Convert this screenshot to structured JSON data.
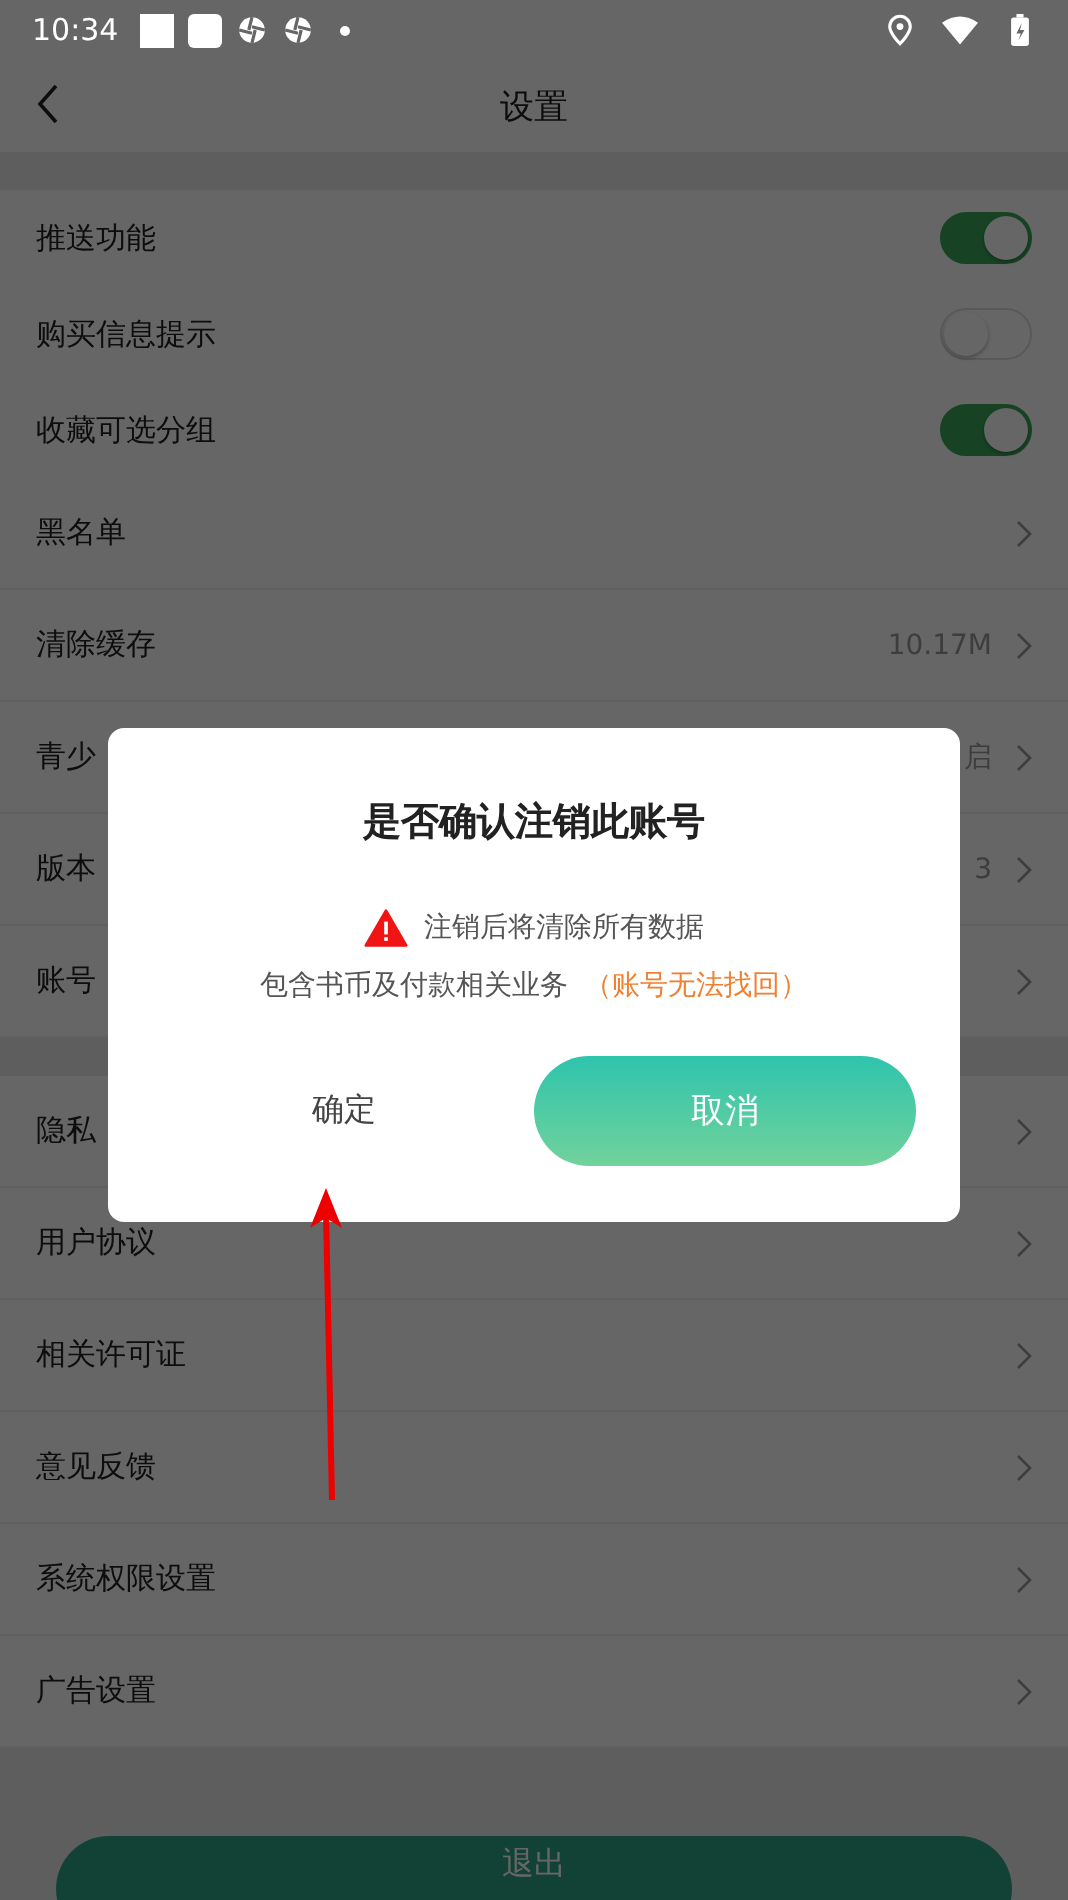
{
  "status_bar": {
    "time": "10:34"
  },
  "header": {
    "title": "设置"
  },
  "groups": [
    {
      "items": [
        {
          "label": "推送功能",
          "kind": "toggle",
          "on": true
        },
        {
          "label": "购买信息提示",
          "kind": "toggle",
          "on": false
        },
        {
          "label": "收藏可选分组",
          "kind": "toggle",
          "on": true
        },
        {
          "label": "黑名单",
          "kind": "link"
        },
        {
          "label": "清除缓存",
          "kind": "link",
          "value": "10.17M"
        },
        {
          "label": "青少",
          "kind": "link",
          "value": "启"
        },
        {
          "label": "版本",
          "kind": "link",
          "value": "3"
        },
        {
          "label": "账号",
          "kind": "link"
        }
      ]
    },
    {
      "items": [
        {
          "label": "隐私",
          "kind": "link"
        },
        {
          "label": "用户协议",
          "kind": "link"
        },
        {
          "label": "相关许可证",
          "kind": "link"
        },
        {
          "label": "意见反馈",
          "kind": "link"
        },
        {
          "label": "系统权限设置",
          "kind": "link"
        },
        {
          "label": "广告设置",
          "kind": "link"
        }
      ]
    }
  ],
  "logout_button": {
    "label": "退出"
  },
  "dialog": {
    "title": "是否确认注销此账号",
    "warning": "注销后将清除所有数据",
    "note": "包含书币及付款相关业务",
    "note_highlight": "（账号无法找回）",
    "confirm": "确定",
    "cancel": "取消"
  }
}
